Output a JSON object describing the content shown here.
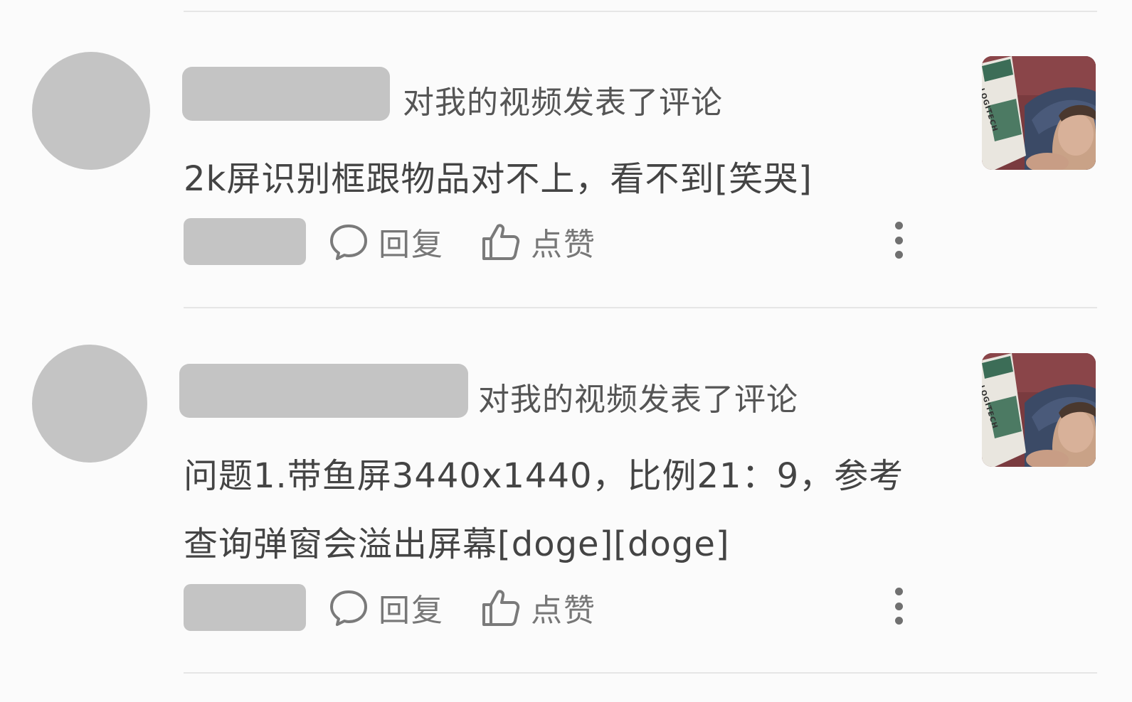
{
  "notifications": [
    {
      "action_text": "对我的视频发表了评论",
      "comment_lines": [
        "2k屏识别框跟物品对不上，看不到[笑哭]"
      ],
      "reply_label": "回复",
      "like_label": "点赞",
      "thumbnail_text": "LOGITECH"
    },
    {
      "action_text": "对我的视频发表了评论",
      "comment_lines": [
        "问题1.带鱼屏3440x1440，比例21：9，参考",
        "查询弹窗会溢出屏幕[doge][doge]"
      ],
      "reply_label": "回复",
      "like_label": "点赞",
      "thumbnail_text": "LOGITECH"
    }
  ],
  "colors": {
    "placeholder": "#c4c4c4",
    "background": "#fbfbfb",
    "divider": "#e6e6e6"
  }
}
